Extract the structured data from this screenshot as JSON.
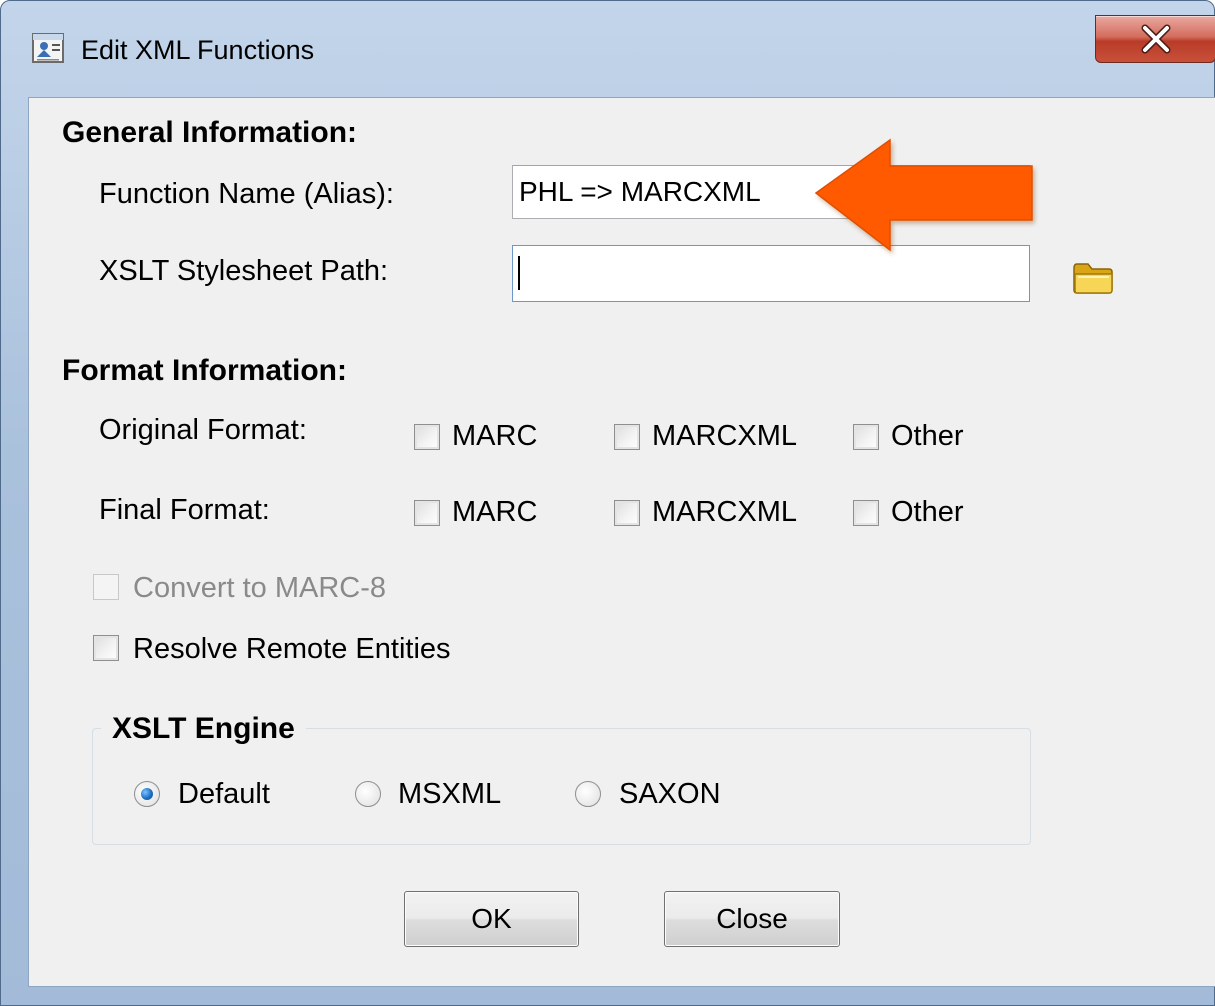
{
  "window": {
    "title": "Edit XML Functions",
    "close_glyph": "X"
  },
  "general": {
    "heading": "General Information:",
    "function_name_label": "Function Name (Alias):",
    "function_name_value": "PHL => MARCXML",
    "xslt_path_label": "XSLT Stylesheet Path:",
    "xslt_path_value": "",
    "browse_icon": "folder-icon"
  },
  "format": {
    "heading": "Format Information:",
    "original_label": "Original Format:",
    "final_label": "Final Format:",
    "options": [
      "MARC",
      "MARCXML",
      "Other"
    ]
  },
  "options": {
    "convert_marc8": "Convert to MARC-8",
    "resolve_entities": "Resolve Remote Entities"
  },
  "engine": {
    "legend": "XSLT Engine",
    "choices": [
      "Default",
      "MSXML",
      "SAXON"
    ],
    "selected": "Default"
  },
  "buttons": {
    "ok": "OK",
    "close": "Close"
  },
  "annotation": {
    "arrow_color": "#ff5a00"
  }
}
